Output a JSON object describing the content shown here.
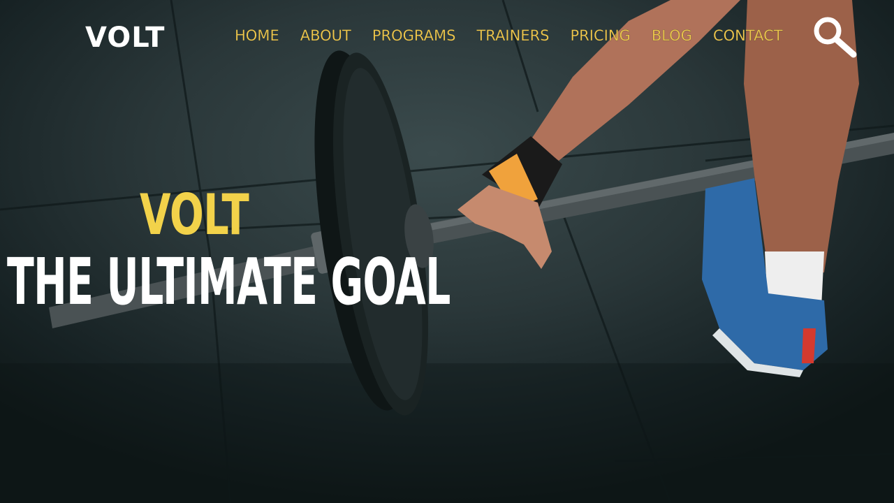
{
  "brand": {
    "logo_text": "VOLT"
  },
  "nav": {
    "items": [
      {
        "label": "HOME"
      },
      {
        "label": "ABOUT"
      },
      {
        "label": "PROGRAMS"
      },
      {
        "label": "TRAINERS"
      },
      {
        "label": "PRICING"
      },
      {
        "label": "BLOG"
      },
      {
        "label": "CONTACT"
      }
    ],
    "search_icon": "search-icon"
  },
  "hero": {
    "eyebrow": "VOLT",
    "title": "THE ULTIMATE GOAL",
    "background_image": "athlete-deadlift-barbell-photo"
  },
  "colors": {
    "accent": "#f2c94c",
    "headline": "#ffffff",
    "background": "#1e2a2c"
  }
}
